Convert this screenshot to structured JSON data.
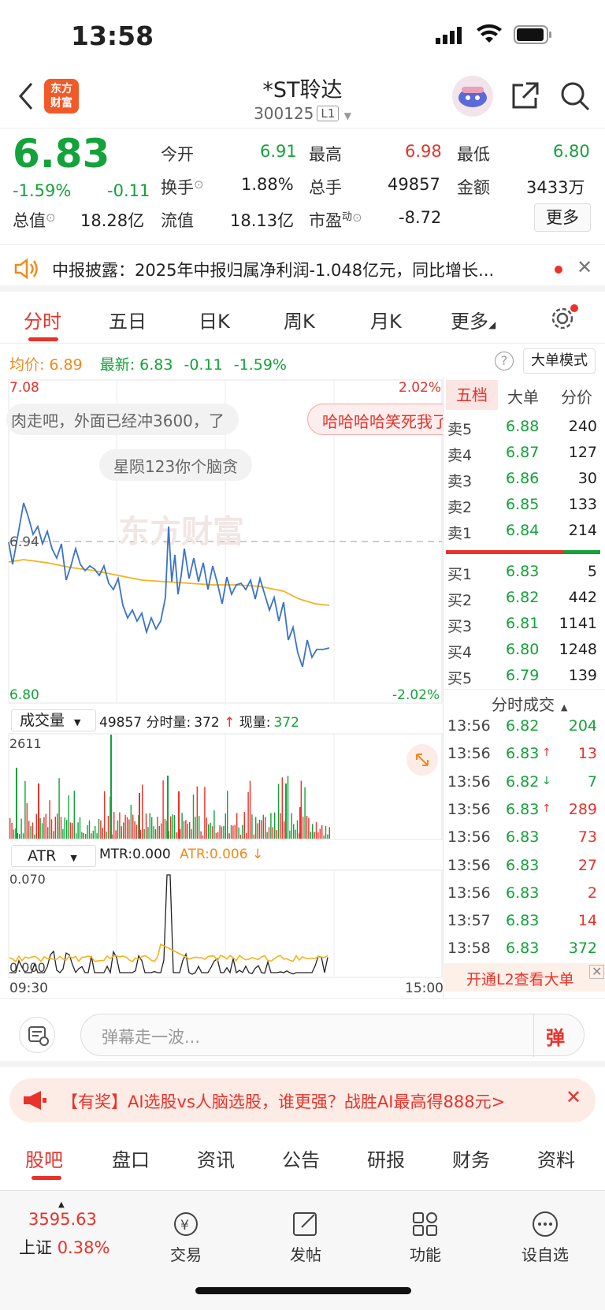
{
  "status": {
    "time": "13:58"
  },
  "header": {
    "title": "*ST聆达",
    "code": "300125",
    "level": "L1",
    "logo_line1": "东方",
    "logo_line2": "财富"
  },
  "quote": {
    "price": "6.83",
    "change_pct": "-1.59%",
    "change": "-0.11",
    "open_label": "今开",
    "open": "6.91",
    "high_label": "最高",
    "high": "6.98",
    "low_label": "最低",
    "low": "6.80",
    "turnover_label": "换手",
    "turnover": "1.88%",
    "volume_label": "总手",
    "volume": "49857",
    "amount_label": "金额",
    "amount": "3433万",
    "mktcap_label": "总值",
    "mktcap": "18.28亿",
    "float_label": "流值",
    "float": "18.13亿",
    "pe_label": "市盈",
    "pe_sup": "动",
    "pe": "-8.72",
    "more_label": "更多"
  },
  "notice": {
    "text": "中报披露：2025年中报归属净利润-1.048亿元，同比增长..."
  },
  "tabs": [
    "分时",
    "五日",
    "日K",
    "周K",
    "月K",
    "更多"
  ],
  "chart_header": {
    "avg_label": "均价:",
    "avg": "6.89",
    "latest_label": "最新:",
    "latest": "6.83",
    "chg": "-0.11",
    "chg_pct": "-1.59%",
    "big_order_mode": "大单模式"
  },
  "chart_labels": {
    "top_price": "7.08",
    "top_pct": "2.02%",
    "mid_price": "6.94",
    "bottom_price": "6.80",
    "bottom_pct": "-2.02%",
    "watermark": "东方财富"
  },
  "danmaku": [
    "肉走吧，外面已经冲3600，了",
    "哈哈哈哈笑死我了",
    "星陨123你个脑贪"
  ],
  "volume_bar": {
    "selector": "成交量",
    "total": "49857",
    "fen_label": "分时量:",
    "fen_value": "372",
    "xian_label": "现量:",
    "xian_value": "372",
    "max": "2611"
  },
  "atr_bar": {
    "selector": "ATR",
    "mtr": "MTR:0.000",
    "atr": "ATR:0.006",
    "max": "0.070",
    "min": "0.000"
  },
  "time_axis": {
    "start": "09:30",
    "end": "15:00"
  },
  "side_tabs": [
    "五档",
    "大单",
    "分价"
  ],
  "sell_orders": [
    {
      "label": "卖5",
      "price": "6.88",
      "vol": "240"
    },
    {
      "label": "卖4",
      "price": "6.87",
      "vol": "127"
    },
    {
      "label": "卖3",
      "price": "6.86",
      "vol": "30"
    },
    {
      "label": "卖2",
      "price": "6.85",
      "vol": "133"
    },
    {
      "label": "卖1",
      "price": "6.84",
      "vol": "214"
    }
  ],
  "buy_orders": [
    {
      "label": "买1",
      "price": "6.83",
      "vol": "5"
    },
    {
      "label": "买2",
      "price": "6.82",
      "vol": "442"
    },
    {
      "label": "买3",
      "price": "6.81",
      "vol": "1141"
    },
    {
      "label": "买4",
      "price": "6.80",
      "vol": "1248"
    },
    {
      "label": "买5",
      "price": "6.79",
      "vol": "139"
    }
  ],
  "ticks_title": "分时成交",
  "ticks": [
    {
      "time": "13:56",
      "price": "6.82",
      "dir": "",
      "vol": "204",
      "color": "green"
    },
    {
      "time": "13:56",
      "price": "6.83",
      "dir": "↑",
      "vol": "13",
      "color": "red"
    },
    {
      "time": "13:56",
      "price": "6.82",
      "dir": "↓",
      "vol": "7",
      "color": "green"
    },
    {
      "time": "13:56",
      "price": "6.83",
      "dir": "↑",
      "vol": "289",
      "color": "red"
    },
    {
      "time": "13:56",
      "price": "6.83",
      "dir": "",
      "vol": "73",
      "color": "red"
    },
    {
      "time": "13:56",
      "price": "6.83",
      "dir": "",
      "vol": "27",
      "color": "red"
    },
    {
      "time": "13:56",
      "price": "6.83",
      "dir": "",
      "vol": "2",
      "color": "red"
    },
    {
      "time": "13:57",
      "price": "6.83",
      "dir": "",
      "vol": "14",
      "color": "red"
    },
    {
      "time": "13:58",
      "price": "6.83",
      "dir": "",
      "vol": "372",
      "color": "green"
    }
  ],
  "l2_promo": "开通L2查看大单",
  "comment": {
    "placeholder": "弹幕走一波...",
    "send": "弹"
  },
  "ad": {
    "text": "【有奖】AI选股vs人脑选股，谁更强？战胜AI最高得888元>"
  },
  "sub_tabs": [
    "股吧",
    "盘口",
    "资讯",
    "公告",
    "研报",
    "财务",
    "资料"
  ],
  "bottom_nav": {
    "index_value": "3595.63",
    "index_name": "上证",
    "index_pct": "0.38%",
    "items": [
      "交易",
      "发帖",
      "功能",
      "设自选"
    ]
  },
  "colors": {
    "up": "#e8322a",
    "down": "#14a23a",
    "avg": "#f5b21b",
    "price_line": "#3b73c4"
  }
}
